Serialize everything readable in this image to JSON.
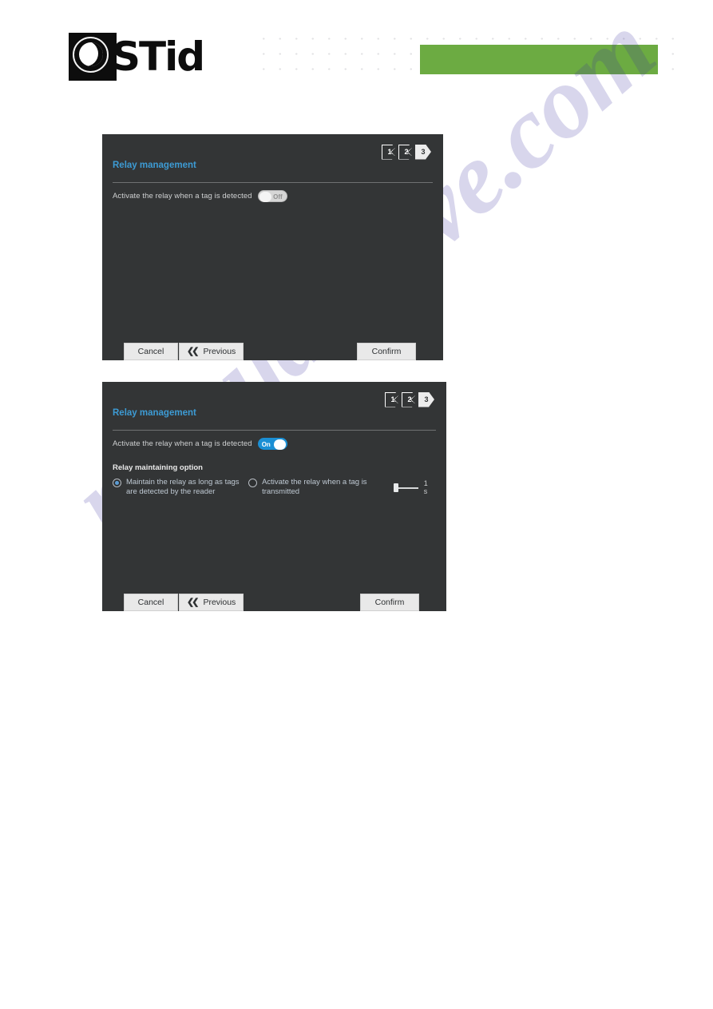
{
  "header": {
    "logo_text": "STid",
    "logo_icon": "stid-circle-logo-icon",
    "green_banner_color": "#6cab42",
    "dot_grid_name": "dot-grid-pattern"
  },
  "watermark": {
    "text": "manualshive.com"
  },
  "dialogs": [
    {
      "id": "dialog-relay-off",
      "title": "Relay management",
      "steps": [
        {
          "label": "1",
          "active": false
        },
        {
          "label": "2",
          "active": false
        },
        {
          "label": "3",
          "active": true
        }
      ],
      "relay": {
        "label": "Activate the relay when a tag is detected",
        "toggle_state": "Off",
        "toggle_on": false
      },
      "maintaining_option_visible": false,
      "buttons": {
        "cancel": "Cancel",
        "previous": "Previous",
        "previous_icon": "double-chevron-left-icon",
        "confirm": "Confirm"
      }
    },
    {
      "id": "dialog-relay-on",
      "title": "Relay management",
      "steps": [
        {
          "label": "1",
          "active": false
        },
        {
          "label": "2",
          "active": false
        },
        {
          "label": "3",
          "active": true
        }
      ],
      "relay": {
        "label": "Activate the relay when a tag is detected",
        "toggle_state": "On",
        "toggle_on": true
      },
      "maintaining_option_visible": true,
      "maintaining_option": {
        "group_title": "Relay maintaining option",
        "options": [
          {
            "label": "Maintain the relay as long as tags are detected by the reader",
            "selected": true
          },
          {
            "label": "Activate the relay  when a tag is transmitted",
            "selected": false
          }
        ],
        "slider": {
          "value_label": "1 s",
          "position_percent": 0
        }
      },
      "buttons": {
        "cancel": "Cancel",
        "previous": "Previous",
        "previous_icon": "double-chevron-left-icon",
        "confirm": "Confirm"
      }
    }
  ],
  "colors": {
    "dialog_bg": "#333536",
    "title_blue": "#3d9bd4",
    "toggle_on_blue": "#1b8fd4",
    "button_bg": "#e9e9e9",
    "accent_green": "#6cab42"
  }
}
